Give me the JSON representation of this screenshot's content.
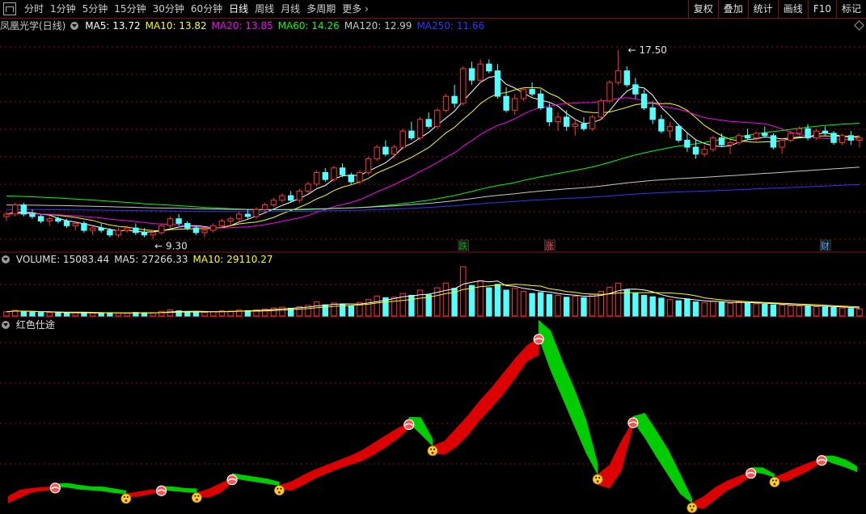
{
  "toolbar": {
    "periods": [
      "分时",
      "1分钟",
      "5分钟",
      "15分钟",
      "30分钟",
      "60分钟",
      "日线",
      "周线",
      "月线",
      "多周期"
    ],
    "active": "日线",
    "more_label": "更多",
    "right_buttons": [
      "复权",
      "叠加",
      "统计",
      "画线",
      "F10",
      "标记"
    ]
  },
  "main_legend": {
    "title": "凤凰光学(日线)",
    "items": [
      {
        "label": "MA5: 13.72",
        "color": "#ffffff"
      },
      {
        "label": "MA10: 13.82",
        "color": "#ffff00"
      },
      {
        "label": "MA20: 13.85",
        "color": "#ff00ff"
      },
      {
        "label": "MA60: 14.26",
        "color": "#00ff00"
      },
      {
        "label": "MA120: 12.99",
        "color": "#c8c8c8"
      },
      {
        "label": "MA250: 11.66",
        "color": "#3333ff"
      }
    ]
  },
  "price_marks": {
    "high": "17.50",
    "low": "9.30"
  },
  "event_markers": [
    "跌",
    "涨",
    "财"
  ],
  "volume_legend": [
    {
      "label": "VOLUME: 15083.44",
      "color": "#e0e0e0"
    },
    {
      "label": "MA5: 27266.33",
      "color": "#e0e0e0"
    },
    {
      "label": "MA10: 29110.27",
      "color": "#ffff00"
    }
  ],
  "indicator_legend": {
    "title": "红色仕途"
  },
  "colors": {
    "up": "#ff3232",
    "down": "#54ffff",
    "grid": "#8a1010",
    "band_up": "#dd0000",
    "band_down": "#00cc00"
  },
  "chart_data": {
    "type": "candlestick",
    "price_range": [
      9.0,
      18.2
    ],
    "candles": [
      [
        10.3,
        10.5,
        10.1,
        10.4
      ],
      [
        10.4,
        10.9,
        10.3,
        10.8
      ],
      [
        10.8,
        10.9,
        10.3,
        10.4
      ],
      [
        10.4,
        10.6,
        10.2,
        10.3
      ],
      [
        10.3,
        10.4,
        10.0,
        10.1
      ],
      [
        10.1,
        10.3,
        9.9,
        10.2
      ],
      [
        10.2,
        10.3,
        10.0,
        10.1
      ],
      [
        10.1,
        10.2,
        9.8,
        9.9
      ],
      [
        9.9,
        10.1,
        9.7,
        10.0
      ],
      [
        10.0,
        10.1,
        9.6,
        9.7
      ],
      [
        9.7,
        9.9,
        9.5,
        9.8
      ],
      [
        9.8,
        10.0,
        9.6,
        9.7
      ],
      [
        9.7,
        9.8,
        9.4,
        9.5
      ],
      [
        9.5,
        9.8,
        9.4,
        9.7
      ],
      [
        9.7,
        9.9,
        9.6,
        9.8
      ],
      [
        9.8,
        10.0,
        9.5,
        9.6
      ],
      [
        9.6,
        9.8,
        9.4,
        9.5
      ],
      [
        9.5,
        9.7,
        9.3,
        9.6
      ],
      [
        9.6,
        10.0,
        9.5,
        9.9
      ],
      [
        9.9,
        10.3,
        9.8,
        10.2
      ],
      [
        10.2,
        10.4,
        9.9,
        10.0
      ],
      [
        10.0,
        10.1,
        9.7,
        9.8
      ],
      [
        9.8,
        9.9,
        9.5,
        9.6
      ],
      [
        9.6,
        9.8,
        9.4,
        9.7
      ],
      [
        9.7,
        10.0,
        9.6,
        9.9
      ],
      [
        9.9,
        10.2,
        9.8,
        10.1
      ],
      [
        10.1,
        10.3,
        9.9,
        10.2
      ],
      [
        10.2,
        10.5,
        10.1,
        10.4
      ],
      [
        10.4,
        10.6,
        10.2,
        10.3
      ],
      [
        10.3,
        10.7,
        10.2,
        10.6
      ],
      [
        10.6,
        10.9,
        10.5,
        10.8
      ],
      [
        10.8,
        11.1,
        10.7,
        11.0
      ],
      [
        11.0,
        11.3,
        10.9,
        11.2
      ],
      [
        11.2,
        11.4,
        10.9,
        11.0
      ],
      [
        11.0,
        11.5,
        10.9,
        11.4
      ],
      [
        11.4,
        11.8,
        11.3,
        11.7
      ],
      [
        11.7,
        12.3,
        11.6,
        12.2
      ],
      [
        12.2,
        12.4,
        11.8,
        11.9
      ],
      [
        11.9,
        12.5,
        11.8,
        12.4
      ],
      [
        12.4,
        12.6,
        12.0,
        12.1
      ],
      [
        12.1,
        12.2,
        11.7,
        11.8
      ],
      [
        11.8,
        12.3,
        11.7,
        12.2
      ],
      [
        12.2,
        12.9,
        12.1,
        12.8
      ],
      [
        12.8,
        13.4,
        12.7,
        13.3
      ],
      [
        13.3,
        13.6,
        12.9,
        13.0
      ],
      [
        13.0,
        13.4,
        12.8,
        13.3
      ],
      [
        13.3,
        14.1,
        13.2,
        14.0
      ],
      [
        14.0,
        14.4,
        13.6,
        13.7
      ],
      [
        13.7,
        14.6,
        13.6,
        14.5
      ],
      [
        14.5,
        14.8,
        14.1,
        14.2
      ],
      [
        14.2,
        15.0,
        14.1,
        14.9
      ],
      [
        14.9,
        15.6,
        14.8,
        15.5
      ],
      [
        15.5,
        16.0,
        15.0,
        15.2
      ],
      [
        15.2,
        16.8,
        15.1,
        16.7
      ],
      [
        16.7,
        17.0,
        16.0,
        16.2
      ],
      [
        16.2,
        17.1,
        16.1,
        16.9
      ],
      [
        16.9,
        17.1,
        16.5,
        16.6
      ],
      [
        16.6,
        16.9,
        15.4,
        15.5
      ],
      [
        15.5,
        15.9,
        14.8,
        14.9
      ],
      [
        14.9,
        15.6,
        14.7,
        15.4
      ],
      [
        15.4,
        15.9,
        15.3,
        15.8
      ],
      [
        15.8,
        16.1,
        15.5,
        15.6
      ],
      [
        15.6,
        15.8,
        14.9,
        15.0
      ],
      [
        15.0,
        15.2,
        14.2,
        14.4
      ],
      [
        14.4,
        14.8,
        14.0,
        14.6
      ],
      [
        14.6,
        14.9,
        14.0,
        14.2
      ],
      [
        14.2,
        14.5,
        13.8,
        14.3
      ],
      [
        14.3,
        14.6,
        14.0,
        14.1
      ],
      [
        14.1,
        14.7,
        14.0,
        14.6
      ],
      [
        14.6,
        15.4,
        14.5,
        15.3
      ],
      [
        15.3,
        16.2,
        15.2,
        16.1
      ],
      [
        16.1,
        17.5,
        16.0,
        16.6
      ],
      [
        16.6,
        16.8,
        15.9,
        16.0
      ],
      [
        16.0,
        16.3,
        15.4,
        15.6
      ],
      [
        15.6,
        15.8,
        14.9,
        15.0
      ],
      [
        15.0,
        15.3,
        14.3,
        14.5
      ],
      [
        14.5,
        14.7,
        13.9,
        14.0
      ],
      [
        14.0,
        14.4,
        13.7,
        14.2
      ],
      [
        14.2,
        14.3,
        13.5,
        13.6
      ],
      [
        13.6,
        13.9,
        13.1,
        13.3
      ],
      [
        13.3,
        13.6,
        12.8,
        13.0
      ],
      [
        13.0,
        13.4,
        12.9,
        13.2
      ],
      [
        13.2,
        13.8,
        13.1,
        13.7
      ],
      [
        13.7,
        13.9,
        13.3,
        13.4
      ],
      [
        13.4,
        13.6,
        13.0,
        13.5
      ],
      [
        13.5,
        13.9,
        13.4,
        13.8
      ],
      [
        13.8,
        14.1,
        13.6,
        13.7
      ],
      [
        13.7,
        14.0,
        13.5,
        13.9
      ],
      [
        13.9,
        14.2,
        13.7,
        13.8
      ],
      [
        13.8,
        13.9,
        13.2,
        13.3
      ],
      [
        13.3,
        13.7,
        13.0,
        13.6
      ],
      [
        13.6,
        14.0,
        13.5,
        13.9
      ],
      [
        13.9,
        14.2,
        13.8,
        14.1
      ],
      [
        14.1,
        14.3,
        13.6,
        13.7
      ],
      [
        13.7,
        14.1,
        13.6,
        14.0
      ],
      [
        14.0,
        14.2,
        13.8,
        13.9
      ],
      [
        13.9,
        14.0,
        13.4,
        13.5
      ],
      [
        13.5,
        13.9,
        13.4,
        13.8
      ],
      [
        13.8,
        14.0,
        13.4,
        13.6
      ],
      [
        13.6,
        13.8,
        13.3,
        13.7
      ]
    ],
    "series": [
      {
        "name": "MA5",
        "color": "#ffffff"
      },
      {
        "name": "MA10",
        "color": "#ffff00"
      },
      {
        "name": "MA20",
        "color": "#ff00ff"
      },
      {
        "name": "MA60",
        "color": "#00ff00"
      },
      {
        "name": "MA120",
        "color": "#c8c8c8"
      },
      {
        "name": "MA250",
        "color": "#3333ff"
      }
    ],
    "volume": [
      18,
      24,
      20,
      16,
      15,
      14,
      13,
      12,
      14,
      15,
      13,
      12,
      14,
      13,
      12,
      15,
      14,
      13,
      20,
      26,
      22,
      18,
      16,
      15,
      19,
      22,
      21,
      25,
      23,
      26,
      30,
      34,
      38,
      33,
      40,
      45,
      60,
      48,
      55,
      50,
      44,
      58,
      70,
      85,
      78,
      80,
      96,
      88,
      110,
      90,
      120,
      140,
      118,
      210,
      130,
      150,
      120,
      135,
      110,
      118,
      105,
      96,
      100,
      92,
      88,
      80,
      84,
      78,
      92,
      105,
      122,
      140,
      110,
      96,
      88,
      82,
      76,
      70,
      65,
      72,
      60,
      56,
      62,
      58,
      54,
      60,
      56,
      52,
      50,
      48,
      46,
      44,
      42,
      44,
      40,
      38,
      36,
      34,
      32,
      30
    ],
    "indicator": [
      0.2,
      0.9,
      1.1,
      1.2,
      1.3,
      1.2,
      1.0,
      0.9,
      0.8,
      0.6,
      0.5,
      0.7,
      0.9,
      1.0,
      0.8,
      0.7,
      0.6,
      1.0,
      1.6,
      2.2,
      2.0,
      1.8,
      1.6,
      1.4,
      1.8,
      2.5,
      3.1,
      3.6,
      4.1,
      4.6,
      5.2,
      6.0,
      6.8,
      7.6,
      8.2,
      7.0,
      5.7,
      6.2,
      7.6,
      9.0,
      10.6,
      12.0,
      13.6,
      15.2,
      16.6,
      17.5,
      14.0,
      11.0,
      8.0,
      5.0,
      2.6,
      3.6,
      6.2,
      8.4,
      6.6,
      4.5,
      2.5,
      0.5,
      -0.5,
      0.2,
      1.2,
      1.9,
      2.4,
      2.9,
      2.7,
      2.3,
      2.8,
      3.4,
      3.9,
      4.3,
      3.8,
      3.4,
      2.9
    ]
  }
}
